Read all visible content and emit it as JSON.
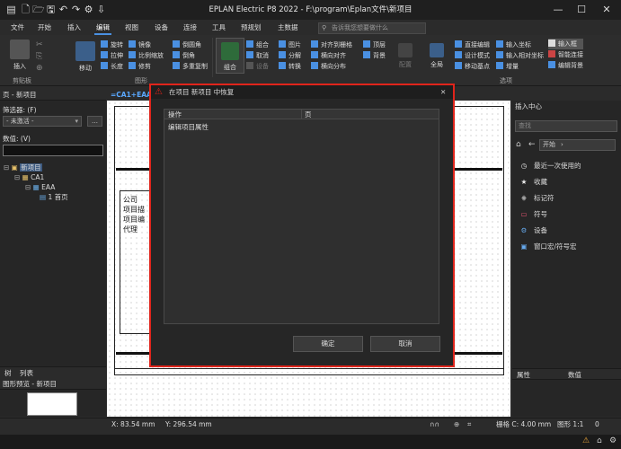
{
  "window": {
    "title": "EPLAN Electric P8 2022 - F:\\program\\Eplan文件\\新项目"
  },
  "menu": [
    "文件",
    "开始",
    "插入",
    "编辑",
    "视图",
    "设备",
    "连接",
    "工具",
    "预规划",
    "主数据"
  ],
  "menu_active_index": 3,
  "search": {
    "placeholder": "告诉我您想要做什么"
  },
  "ribbon": {
    "paste": "插入",
    "move": "移动",
    "col1": [
      "旋转",
      "拉伸",
      "长度"
    ],
    "col2": [
      "镜像",
      "比例缩放",
      "修剪"
    ],
    "col3": [
      "倒圆角",
      "倒角",
      "多重复制"
    ],
    "group_btn": "组合",
    "col4": [
      "组合",
      "取消",
      "设备"
    ],
    "col5": [
      "图片",
      "分解",
      "转换"
    ],
    "col6": [
      "对齐到栅格",
      "横向对齐",
      "横向分布"
    ],
    "col7": [
      "顶层",
      "背景"
    ],
    "config": "配置",
    "global": "全局",
    "col8": [
      "直接编辑",
      "设计模式",
      "移动基点"
    ],
    "col9": [
      "输入坐标",
      "输入相对坐标",
      "增量"
    ],
    "col10": [
      "输入框",
      "智能连接",
      "编辑背景"
    ],
    "groups": {
      "clipboard": "剪贴板",
      "graphics": "图形",
      "options": "选项"
    }
  },
  "left_panel": {
    "header": "页 - 新项目",
    "filter_label": "筛选器: (F)",
    "filter_value": "- 未激活 -",
    "value_label": "数值: (V)",
    "tree": [
      "新项目",
      "CA1",
      "EAA",
      "1 首页"
    ],
    "tabs": [
      "树",
      "列表"
    ],
    "preview_header": "图形预览 - 新项目"
  },
  "canvas": {
    "tab": "=CA1+EAA",
    "title_block": [
      "公司",
      "项目描",
      "项目编",
      "代理"
    ]
  },
  "dialog": {
    "title": "在项目 新项目 中恢复",
    "col_operation": "操作",
    "col_page": "页",
    "rows": [
      {
        "operation": "编辑项目属性",
        "page": ""
      }
    ],
    "ok": "确定",
    "cancel": "取消"
  },
  "right_panel": {
    "header": "插入中心",
    "search_placeholder": "查找",
    "breadcrumb": "开始",
    "items": [
      {
        "icon": "recent-icon",
        "label": "最近一次使用的"
      },
      {
        "icon": "star-icon",
        "label": "收藏"
      },
      {
        "icon": "bookmark-icon",
        "label": "标记符"
      },
      {
        "icon": "symbol-icon",
        "label": "符号"
      },
      {
        "icon": "device-icon",
        "label": "设备"
      },
      {
        "icon": "window-macro-icon",
        "label": "窗口宏/符号宏"
      }
    ],
    "prop_tabs": [
      "属性",
      "数值"
    ]
  },
  "status": {
    "x": "X: 83.54 mm",
    "y": "Y: 296.54 mm",
    "grid": "栅格 C: 4.00 mm",
    "scale": "图形 1:1",
    "zero": "0"
  },
  "colors": {
    "accent": "#4a90e2",
    "dialog_border": "#e0241b"
  }
}
